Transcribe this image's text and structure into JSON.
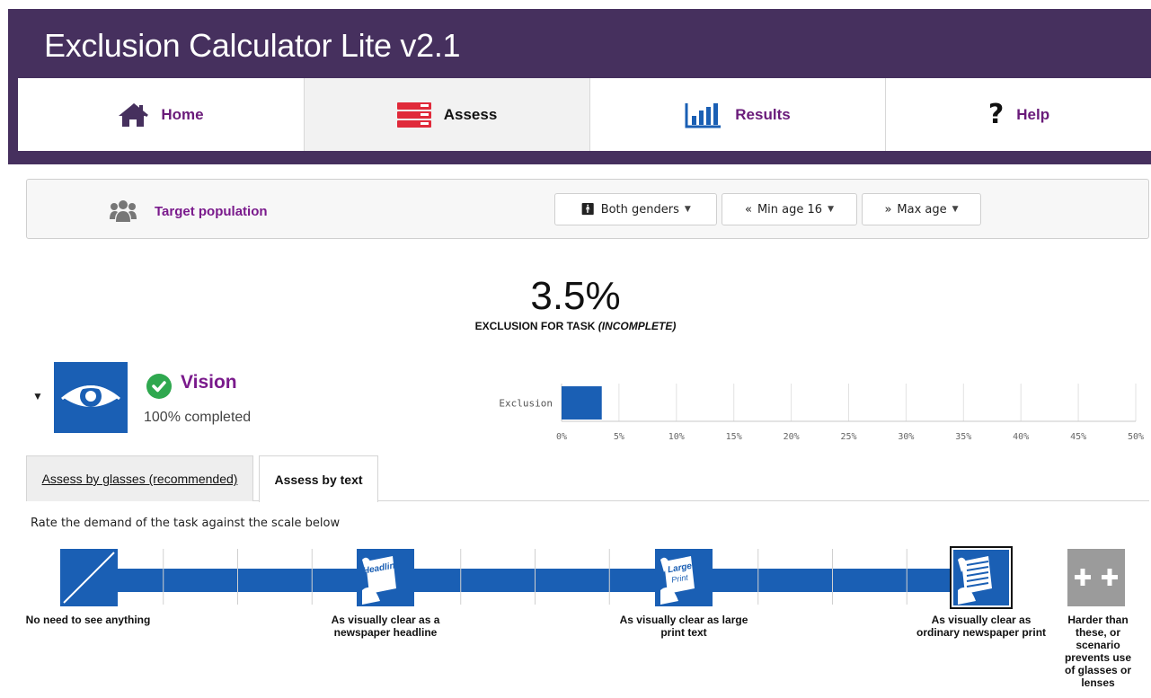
{
  "app": {
    "title": "Exclusion Calculator Lite v2.1"
  },
  "nav": [
    {
      "label": "Home",
      "icon": "home-icon"
    },
    {
      "label": "Assess",
      "icon": "assess-list-icon"
    },
    {
      "label": "Results",
      "icon": "bar-chart-icon"
    },
    {
      "label": "Help",
      "icon": "question-mark-icon"
    }
  ],
  "target": {
    "label": "Target population",
    "icon": "people-icon",
    "gender": "Both genders",
    "min_age": "Min age 16",
    "max_age": "Max age"
  },
  "result": {
    "percent": "3.5%",
    "caption_prefix": "EXCLUSION FOR TASK ",
    "caption_suffix": "(INCOMPLETE)"
  },
  "vision": {
    "title": "Vision",
    "progress": "100% completed",
    "icon": "eye-icon",
    "status_icon": "check-circle-icon"
  },
  "chart_data": {
    "type": "bar",
    "orientation": "horizontal",
    "categories": [
      "Exclusion"
    ],
    "values": [
      3.5
    ],
    "xlim": [
      0,
      50
    ],
    "xticks": [
      "0%",
      "5%",
      "10%",
      "15%",
      "20%",
      "25%",
      "30%",
      "35%",
      "40%",
      "45%",
      "50%"
    ],
    "bar_color": "#1a5fb4",
    "grid": true
  },
  "tabs": [
    {
      "label": "Assess by glasses (recommended)",
      "active": false
    },
    {
      "label": "Assess by text",
      "active": true
    }
  ],
  "instructions": "Rate the demand of the task against the scale below",
  "scale": {
    "color": "#1a5fb4",
    "selected_index": 3,
    "icon_texts": {
      "headline": "Headline",
      "large": "Large",
      "print": "Print"
    },
    "levels": [
      {
        "label": [
          "No need to see anything"
        ],
        "icon": "slash-icon"
      },
      {
        "label": [
          "As visually clear as a",
          "newspaper headline"
        ],
        "icon": "headline-newspaper-icon"
      },
      {
        "label": [
          "As visually clear as large",
          "print text"
        ],
        "icon": "large-print-icon"
      },
      {
        "label": [
          "As visually clear as",
          "ordinary newspaper print"
        ],
        "icon": "newspaper-print-icon"
      },
      {
        "label": [
          "Harder than",
          "these, or",
          "scenario",
          "prevents use",
          "of glasses or",
          "lenses"
        ],
        "icon": "plus-plus-icon"
      }
    ]
  }
}
